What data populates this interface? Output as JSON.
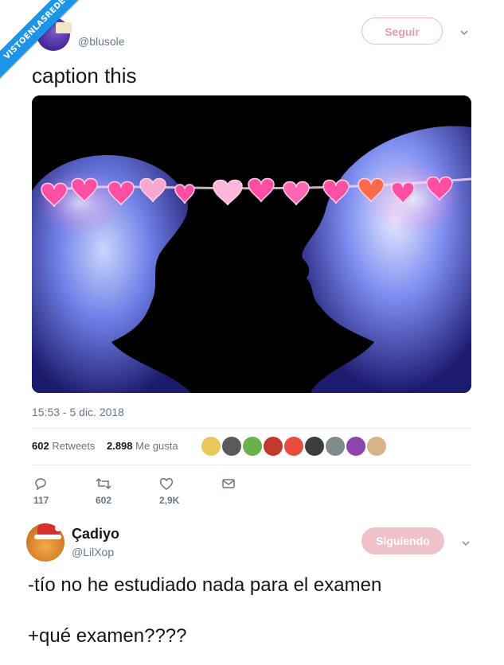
{
  "watermark": {
    "text": "VISTOENLASREDES"
  },
  "tweet1": {
    "handle": "@blusole",
    "follow_label": "Seguir",
    "text": "caption this",
    "timestamp": "15:53 - 5 dic. 2018",
    "stats": {
      "retweets_count": "602",
      "retweets_label": "Retweets",
      "likes_count": "2.898",
      "likes_label": "Me gusta"
    },
    "actions": {
      "replies": "117",
      "retweets": "602",
      "likes": "2,9K"
    },
    "liker_colors": [
      "#e8c85a",
      "#5a5a5a",
      "#6ab04c",
      "#c0392b",
      "#e74c3c",
      "#3d3d3d",
      "#7f8c8d",
      "#8e44ad",
      "#d6b38a"
    ]
  },
  "tweet2": {
    "name": "Çadiyo",
    "handle": "@LilXop",
    "following_label": "Siguiendo",
    "line1": "-tío no he estudiado nada para el examen",
    "line2": "+qué examen????"
  },
  "colors": {
    "brand_blue": "#1d95e6",
    "muted": "#657786",
    "pink_button": "#efc2ca"
  }
}
